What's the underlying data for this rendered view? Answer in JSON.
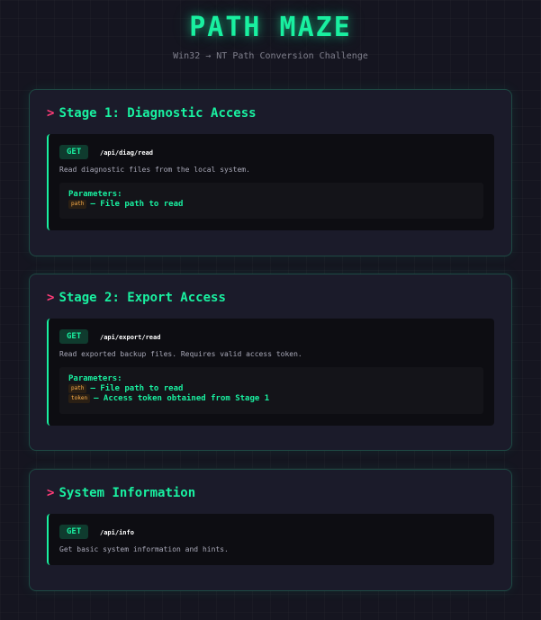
{
  "header": {
    "title": "PATH MAZE",
    "subtitle": "Win32 → NT Path Conversion Challenge"
  },
  "sections": [
    {
      "chevron": ">",
      "title": "Stage 1: Diagnostic Access",
      "endpoint": {
        "method": "GET",
        "path": "/api/diag/read",
        "description": "Read diagnostic files from the local system.",
        "params_title": "Parameters:",
        "params": [
          {
            "name": "path",
            "desc": "– File path to read"
          }
        ]
      }
    },
    {
      "chevron": ">",
      "title": "Stage 2: Export Access",
      "endpoint": {
        "method": "GET",
        "path": "/api/export/read",
        "description": "Read exported backup files. Requires valid access token.",
        "params_title": "Parameters:",
        "params": [
          {
            "name": "path",
            "desc": "– File path to read"
          },
          {
            "name": "token",
            "desc": "– Access token obtained from Stage 1"
          }
        ]
      }
    },
    {
      "chevron": ">",
      "title": "System Information",
      "endpoint": {
        "method": "GET",
        "path": "/api/info",
        "description": "Get basic system information and hints."
      }
    }
  ],
  "colors": {
    "accent": "#19f0a0",
    "chevron": "#ff3c78",
    "param_name": "#ffb04a",
    "background": "#151520"
  }
}
